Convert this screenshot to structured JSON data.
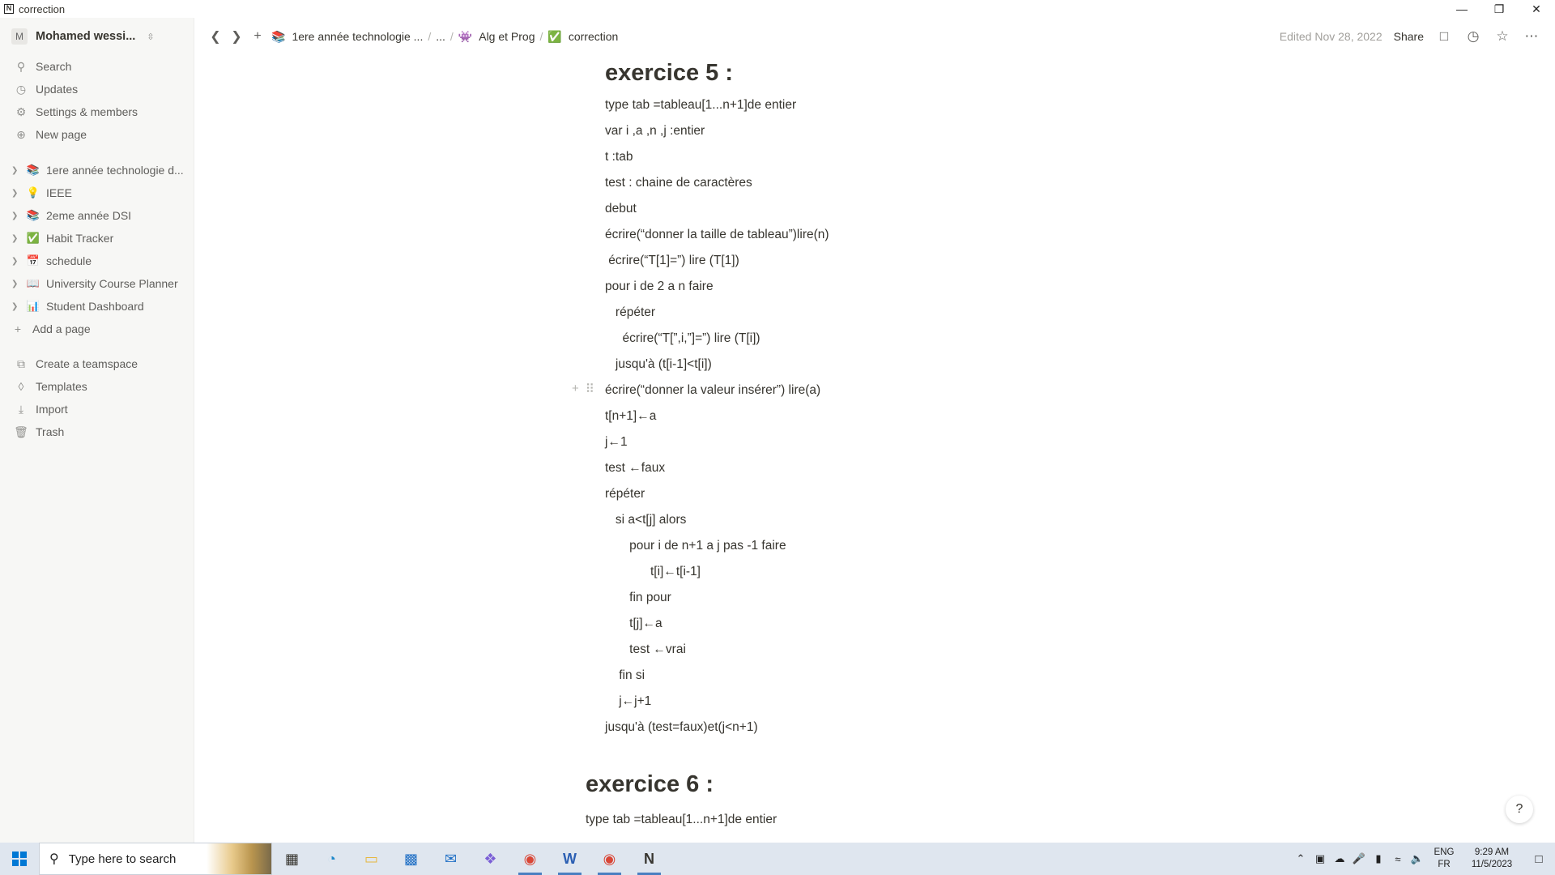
{
  "window": {
    "title": "correction",
    "app_icon": "N",
    "controls": [
      "minimize",
      "restore",
      "close"
    ]
  },
  "sidebar": {
    "workspace": {
      "avatar": "M",
      "name": "Mohamed wessi..."
    },
    "top_items": [
      {
        "label": "Search",
        "icon": "search-icon"
      },
      {
        "label": "Updates",
        "icon": "clock-icon"
      },
      {
        "label": "Settings & members",
        "icon": "gear-icon"
      },
      {
        "label": "New page",
        "icon": "plus-circle-icon"
      }
    ],
    "pages": [
      {
        "label": "1ere année technologie d...",
        "emoji": "📚"
      },
      {
        "label": "IEEE",
        "emoji": "💡"
      },
      {
        "label": "2eme année DSI",
        "emoji": "📚"
      },
      {
        "label": "Habit Tracker",
        "emoji": "✅"
      },
      {
        "label": "schedule",
        "emoji": "📅"
      },
      {
        "label": "University Course Planner",
        "emoji": "📖"
      },
      {
        "label": "Student Dashboard",
        "emoji": "📊"
      }
    ],
    "add_page": "Add a page",
    "bottom_items": [
      {
        "label": "Create a teamspace",
        "icon": "teamspace-icon"
      },
      {
        "label": "Templates",
        "icon": "templates-icon"
      },
      {
        "label": "Import",
        "icon": "import-icon"
      },
      {
        "label": "Trash",
        "icon": "trash-icon"
      }
    ]
  },
  "topbar": {
    "breadcrumbs": [
      {
        "label": "1ere année technologie ...",
        "emoji": "📚"
      },
      {
        "label": "...",
        "emoji": ""
      },
      {
        "label": "Alg et Prog",
        "emoji": "👾"
      },
      {
        "label": "correction",
        "emoji": "✅"
      }
    ],
    "separator": "/",
    "edited": "Edited Nov 28, 2022",
    "share": "Share"
  },
  "document": {
    "exercise5_title": "exercice 5 :",
    "exercise5_lines": [
      "type tab =tableau[1...n+1]de entier",
      "var i ,a ,n ,j :entier",
      "t :tab",
      "test : chaine de caractères",
      "debut",
      "écrire(“donner la taille de tableau”)lire(n)",
      " écrire(“T[1]=”) lire (T[1])",
      "pour i de 2 a n faire",
      "   répéter",
      "     écrire(“T[”,i,”]=”) lire (T[i])",
      "   jusqu'à (t[i-1]<t[i])",
      "écrire(“donner la valeur insérer”) lire(a)",
      "t[n+1]←a",
      "j←1",
      "test ←faux",
      "répéter",
      "   si a<t[j] alors",
      "       pour i de n+1 a j pas -1 faire",
      "             t[i]←t[i-1]",
      "       fin pour",
      "       t[j]←a",
      "       test ←vrai",
      "    fin si",
      "    j←j+1",
      "jusqu'à (test=faux)et(j<n+1)"
    ],
    "exercise6_title": "exercice 6 :",
    "exercise6_lines": [
      "type tab =tableau[1...n+1]de entier"
    ]
  },
  "help": "?",
  "taskbar": {
    "search_placeholder": "Type here to search",
    "apps": [
      "task-view-icon",
      "edge-icon",
      "file-explorer-icon",
      "store-icon",
      "mail-icon",
      "copilot-icon",
      "chrome-icon",
      "word-icon",
      "chrome-icon",
      "notion-icon"
    ],
    "lang_top": "ENG",
    "lang_bottom": "FR",
    "time": "9:29 AM",
    "date": "11/5/2023"
  }
}
